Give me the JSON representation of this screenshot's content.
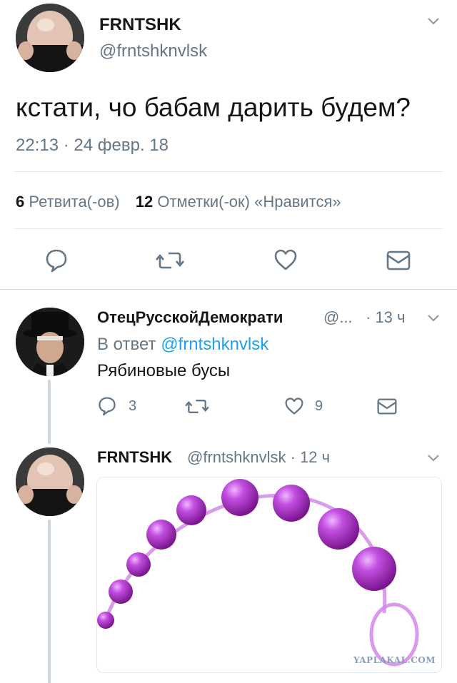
{
  "main": {
    "name": "FRNTSHK",
    "handle": "@frntshknvlsk",
    "text": "кстати, чо бабам дарить будем?",
    "timestamp": "22:13 · 24 февр. 18",
    "retweets_count": "6",
    "retweets_label": "Ретвита(-ов)",
    "likes_count": "12",
    "likes_label": "Отметки(-ок) «Нравится»"
  },
  "replies": [
    {
      "name": "ОтецРусскойДемократи",
      "handle": "@...",
      "time": "· 13 ч",
      "reply_to_prefix": "В ответ",
      "reply_to_handle": "@frntshknvlsk",
      "text": "Рябиновые бусы",
      "reply_count": "3",
      "like_count": "9"
    },
    {
      "name": "FRNTSHK",
      "handle": "@frntshknvlsk · 12 ч",
      "watermark": "YAPLAKAL.COM"
    }
  ],
  "colors": {
    "text": "#14171a",
    "muted": "#657786",
    "link": "#1da1f2",
    "icon": "#657786",
    "beads": "#b23ad6"
  }
}
